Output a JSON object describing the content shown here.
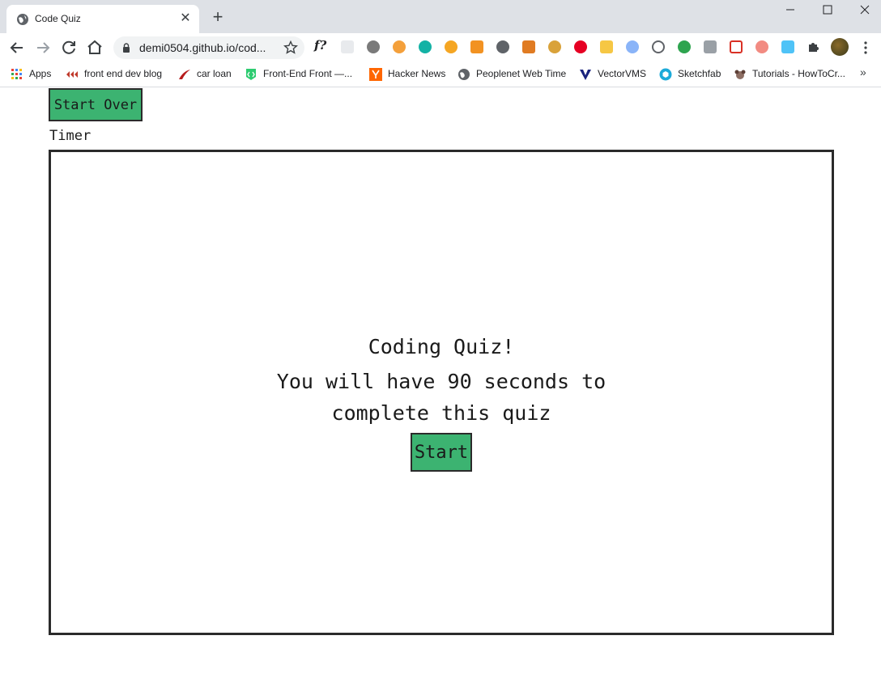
{
  "browser": {
    "tab_title": "Code Quiz",
    "new_tab_symbol": "+",
    "url": "demi0504.github.io/cod...",
    "bookmarks": [
      {
        "label": "Apps",
        "icon": "apps-grid-icon"
      },
      {
        "label": "front end dev blog",
        "icon": "blog-icon"
      },
      {
        "label": "car loan",
        "icon": "car-loan-icon"
      },
      {
        "label": "Front-End Front —...",
        "icon": "frontend-front-icon"
      },
      {
        "label": "Hacker News",
        "icon": "hacker-news-icon"
      },
      {
        "label": "Peoplenet Web Time",
        "icon": "globe-icon"
      },
      {
        "label": "VectorVMS",
        "icon": "vectorvms-icon"
      },
      {
        "label": "Sketchfab",
        "icon": "sketchfab-icon"
      },
      {
        "label": "Tutorials - HowToCr...",
        "icon": "tutorials-icon"
      }
    ],
    "extension_f_label": "f?",
    "more_bookmarks": "»"
  },
  "page": {
    "start_over_label": "Start Over",
    "timer_label": "Timer",
    "quiz_title": "Coding Quiz!",
    "quiz_description": "You will have 90 seconds to complete this quiz",
    "start_label": "Start"
  },
  "colors": {
    "button_green": "#3cb371",
    "border_dark": "#2b2b2b",
    "tabstrip_bg": "#dee1e6"
  }
}
